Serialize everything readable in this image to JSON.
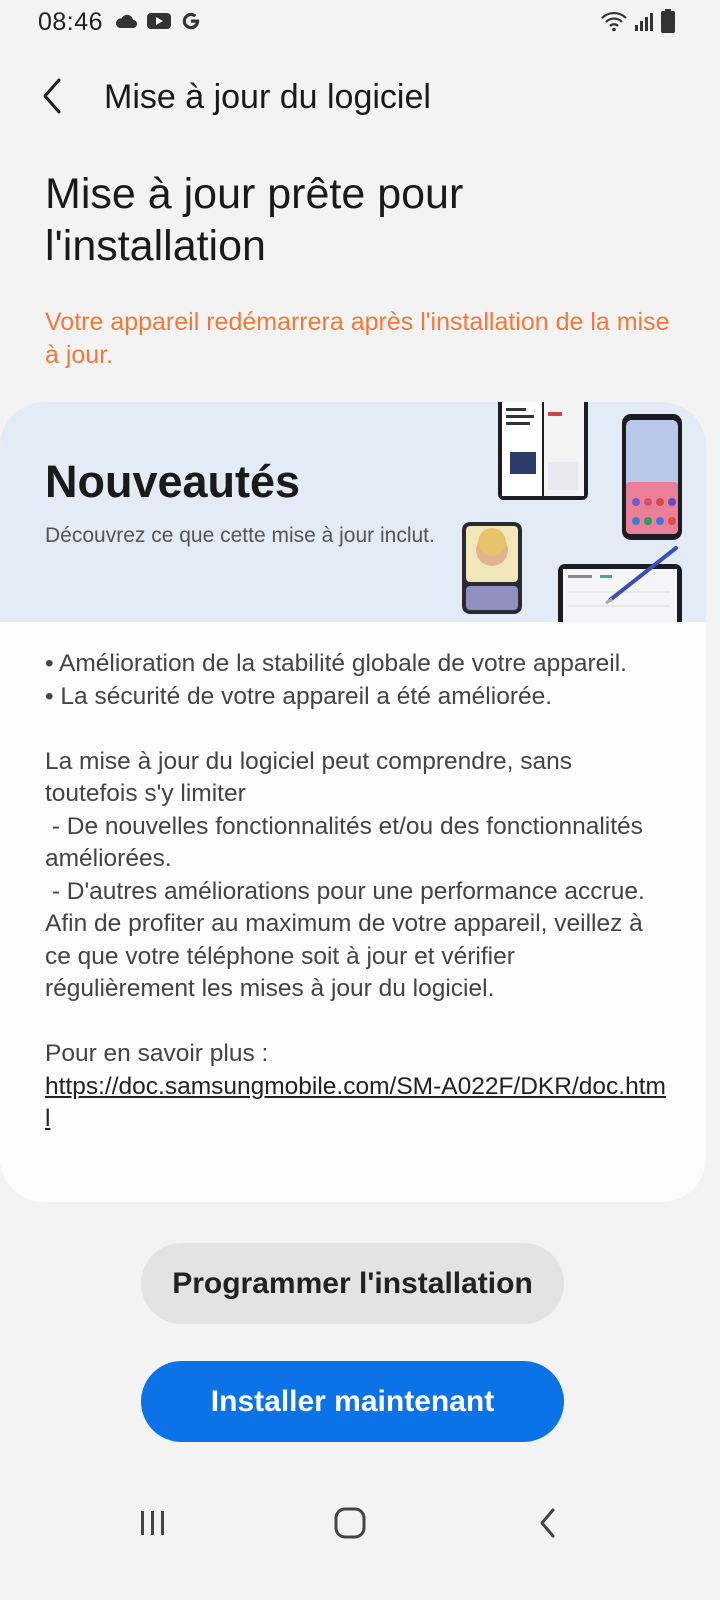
{
  "status_bar": {
    "time": "08:46",
    "left_icons": [
      "cloud-icon",
      "youtube-icon",
      "google-icon"
    ],
    "right_icons": [
      "wifi-icon",
      "signal-icon",
      "battery-icon"
    ]
  },
  "app_bar": {
    "title": "Mise à jour du logiciel",
    "back_icon": "chevron-left-icon"
  },
  "heading": "Mise à jour prête pour l'installation",
  "warning": "Votre appareil redémarrera après l'installation de la mise à jour.",
  "card": {
    "title": "Nouveautés",
    "subtitle": "Découvrez ce que cette mise à jour inclut.",
    "notes": [
      "• Amélioration de la stabilité globale de votre appareil.",
      "• La sécurité de votre appareil a été améliorée.",
      "La mise à jour du logiciel peut comprendre, sans toutefois s'y limiter",
      " - De nouvelles fonctionnalités et/ou des fonctionnalités améliorées.",
      " - D'autres améliorations pour une performance accrue.",
      "Afin de profiter au maximum de votre appareil, veillez à ce que votre téléphone soit à jour et vérifier régulièrement les mises à jour du logiciel.",
      "Pour en savoir plus :"
    ],
    "link": "https://doc.samsungmobile.com/SM-A022F/DKR/doc.html"
  },
  "buttons": {
    "schedule": "Programmer l'installation",
    "install": "Installer maintenant"
  },
  "colors": {
    "accent": "#0b72e7",
    "warning": "#ef7a3a",
    "banner": "#e2ebf6",
    "background": "#f3f3f3"
  },
  "nav_bar": {
    "icons": [
      "recent-apps-icon",
      "home-icon",
      "back-icon"
    ]
  }
}
